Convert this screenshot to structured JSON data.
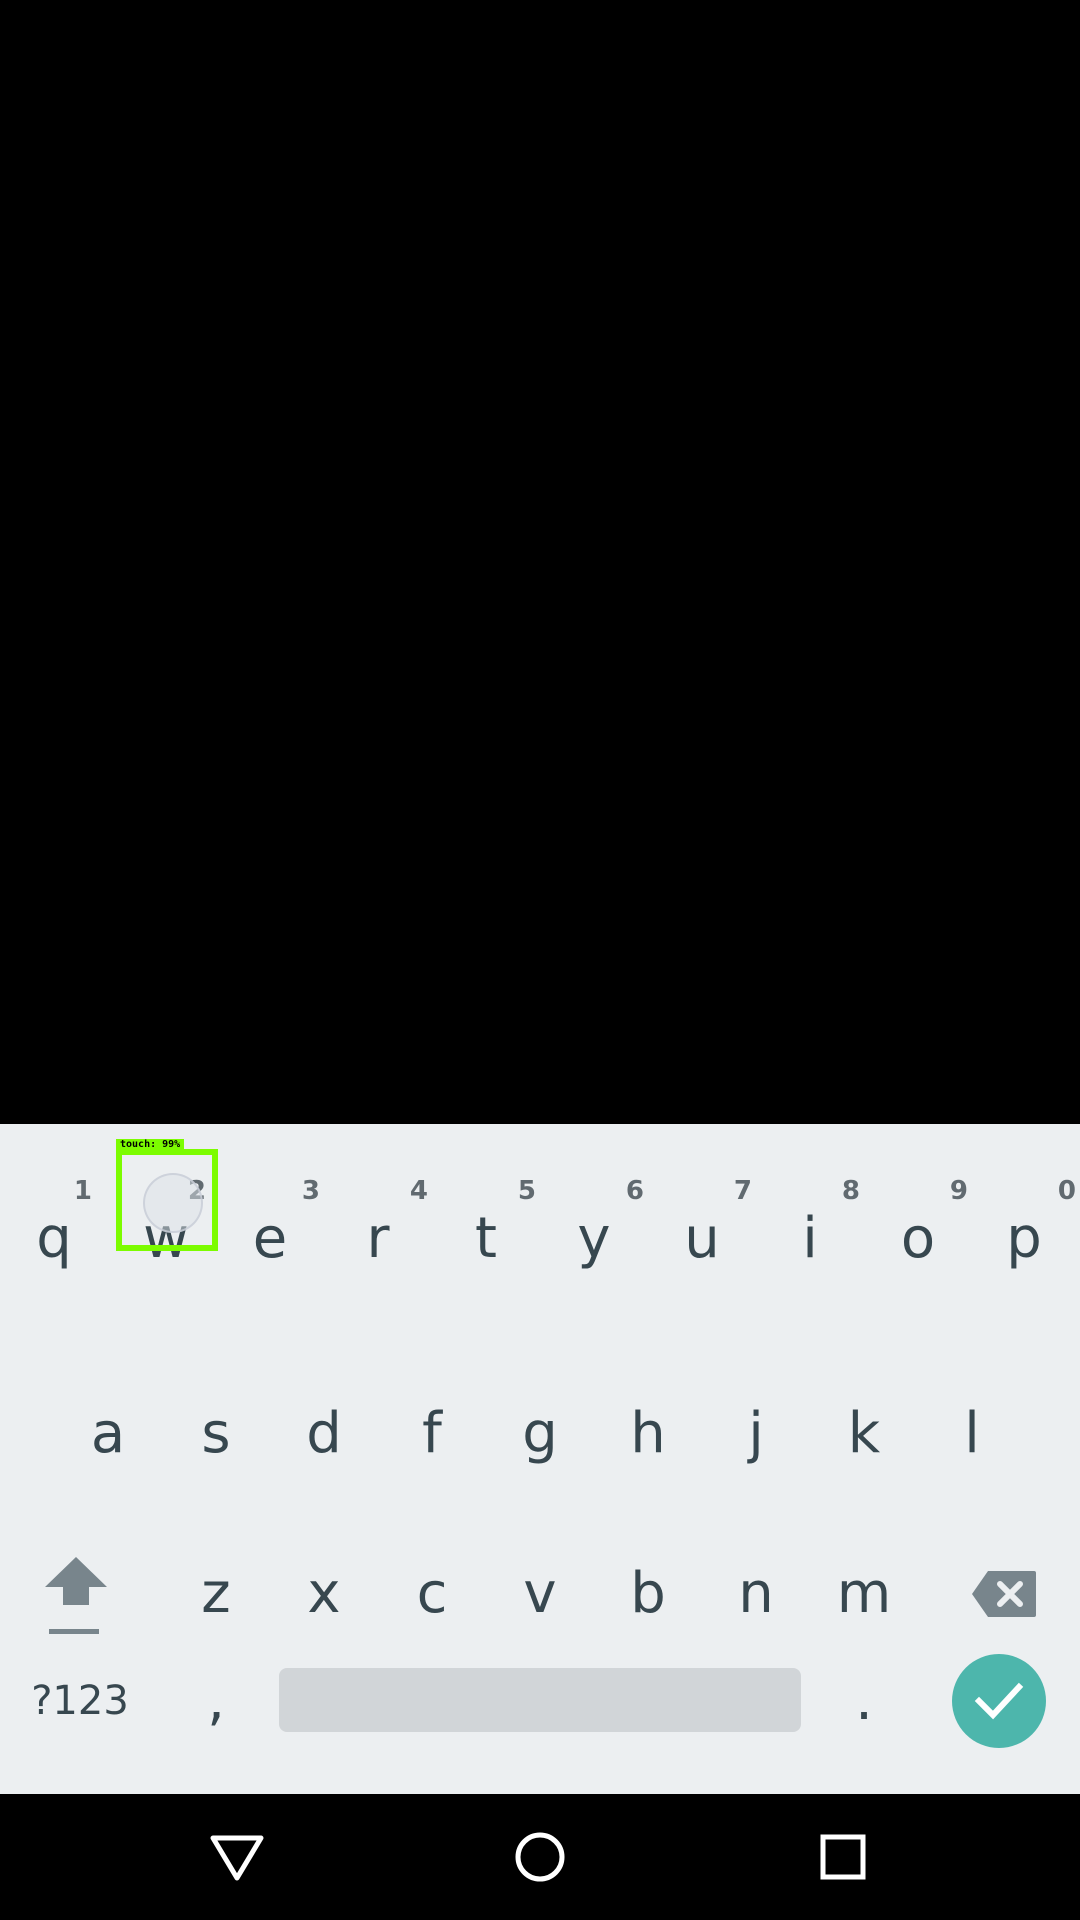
{
  "keyboard": {
    "row1": [
      {
        "letter": "q",
        "hint": "1"
      },
      {
        "letter": "w",
        "hint": "2"
      },
      {
        "letter": "e",
        "hint": "3"
      },
      {
        "letter": "r",
        "hint": "4"
      },
      {
        "letter": "t",
        "hint": "5"
      },
      {
        "letter": "y",
        "hint": "6"
      },
      {
        "letter": "u",
        "hint": "7"
      },
      {
        "letter": "i",
        "hint": "8"
      },
      {
        "letter": "o",
        "hint": "9"
      },
      {
        "letter": "p",
        "hint": "0"
      }
    ],
    "row2": [
      "a",
      "s",
      "d",
      "f",
      "g",
      "h",
      "j",
      "k",
      "l"
    ],
    "row3": [
      "z",
      "x",
      "c",
      "v",
      "b",
      "n",
      "m"
    ],
    "symbols_label": "?123",
    "comma_label": ",",
    "period_label": ".",
    "shift_icon": "shift-icon",
    "backspace_icon": "backspace-icon",
    "enter_icon": "checkmark-icon",
    "enter_color": "#4db6ac",
    "background_color": "#eceff1",
    "key_text_color": "#37474f"
  },
  "touch_overlay": {
    "label": "touch: 99%",
    "color": "#7cfc00"
  },
  "navbar": {
    "back_icon": "back-triangle-icon",
    "home_icon": "home-circle-icon",
    "recents_icon": "recents-square-icon"
  }
}
